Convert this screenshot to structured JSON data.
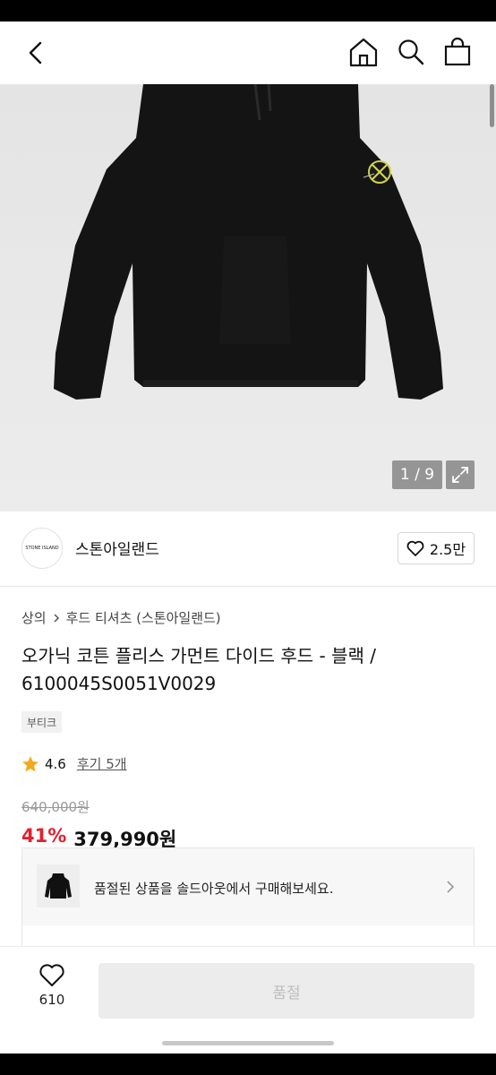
{
  "header": {
    "back_icon": "chevron-left-icon",
    "icons": [
      "home-icon",
      "search-icon",
      "shopping-bag-icon"
    ]
  },
  "gallery": {
    "counter": "1 / 9",
    "expand_icon": "expand-icon"
  },
  "brand": {
    "logo_text": "STONE ISLAND",
    "name": "스톤아일랜드",
    "likes": "2.5만"
  },
  "breadcrumb": {
    "items": [
      "상의",
      "후드 티셔츠 (스톤아일랜드)"
    ]
  },
  "product": {
    "title": "오가닉 코튼 플리스 가먼트 다이드 후드 - 블랙 / 6100045S0051V0029",
    "tag": "부티크",
    "rating": "4.6",
    "reviews": "후기 5개",
    "original_price": "640,000원",
    "discount": "41%",
    "price": "379,990원"
  },
  "soldout": {
    "message": "품절된 상품을 솔드아웃에서 구매해보세요."
  },
  "bottom": {
    "like_count": "610",
    "buy_label": "품절"
  },
  "colors": {
    "discount": "#e4202d",
    "disabled_button": "#ececec"
  }
}
